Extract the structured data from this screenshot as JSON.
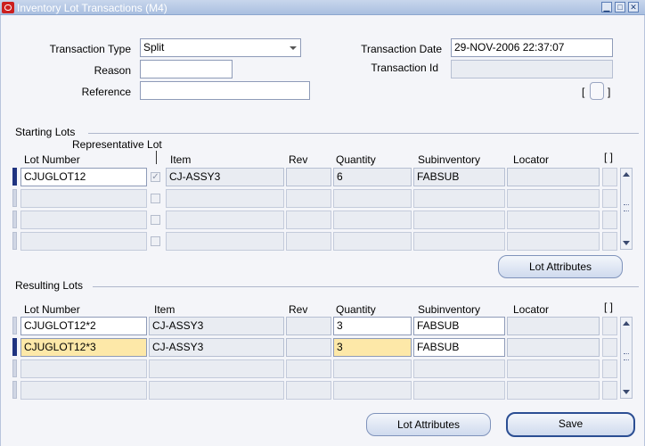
{
  "window": {
    "title": "Inventory Lot Transactions (M4)",
    "minimize_glyph": "▁",
    "maximize_glyph": "□",
    "close_glyph": "✕"
  },
  "form": {
    "transaction_type_label": "Transaction Type",
    "transaction_type_value": "Split",
    "reason_label": "Reason",
    "reason_value": "",
    "reference_label": "Reference",
    "reference_value": "",
    "transaction_date_label": "Transaction Date",
    "transaction_date_value": "29-NOV-2006 22:37:07",
    "transaction_id_label": "Transaction Id",
    "transaction_id_value": "",
    "bracket_open": "[",
    "bracket_close": "]"
  },
  "starting_lots": {
    "section_title": "Starting Lots",
    "columns": {
      "lot_number": "Lot Number",
      "representative_lot": "Representative Lot",
      "item": "Item",
      "rev": "Rev",
      "quantity": "Quantity",
      "subinventory": "Subinventory",
      "locator": "Locator",
      "flex": "[ ]"
    },
    "rows": [
      {
        "lot_number": "CJUGLOT12",
        "representative": "✓",
        "item": "CJ-ASSY3",
        "rev": "",
        "quantity": "6",
        "subinventory": "FABSUB",
        "locator": ""
      },
      {
        "lot_number": "",
        "representative": "",
        "item": "",
        "rev": "",
        "quantity": "",
        "subinventory": "",
        "locator": ""
      },
      {
        "lot_number": "",
        "representative": "",
        "item": "",
        "rev": "",
        "quantity": "",
        "subinventory": "",
        "locator": ""
      },
      {
        "lot_number": "",
        "representative": "",
        "item": "",
        "rev": "",
        "quantity": "",
        "subinventory": "",
        "locator": ""
      }
    ],
    "lot_attributes_button": "Lot Attributes"
  },
  "resulting_lots": {
    "section_title": "Resulting Lots",
    "columns": {
      "lot_number": "Lot Number",
      "item": "Item",
      "rev": "Rev",
      "quantity": "Quantity",
      "subinventory": "Subinventory",
      "locator": "Locator",
      "flex": "[ ]"
    },
    "rows": [
      {
        "lot_number": "CJUGLOT12*2",
        "item": "CJ-ASSY3",
        "rev": "",
        "quantity": "3",
        "subinventory": "FABSUB",
        "locator": ""
      },
      {
        "lot_number": "CJUGLOT12*3",
        "item": "CJ-ASSY3",
        "rev": "",
        "quantity": "3",
        "subinventory": "FABSUB",
        "locator": ""
      },
      {
        "lot_number": "",
        "item": "",
        "rev": "",
        "quantity": "",
        "subinventory": "",
        "locator": ""
      },
      {
        "lot_number": "",
        "item": "",
        "rev": "",
        "quantity": "",
        "subinventory": "",
        "locator": ""
      }
    ]
  },
  "footer": {
    "lot_attributes_button": "Lot Attributes",
    "save_button": "Save"
  },
  "colors": {
    "current_row_marker": "#1f3380",
    "current_row_highlight": "#fde8a8",
    "titlebar": "#a9bfe0"
  }
}
